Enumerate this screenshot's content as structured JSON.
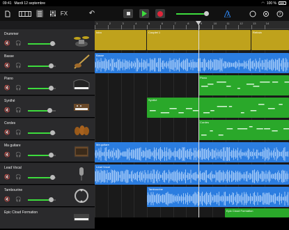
{
  "status": {
    "time": "09:41",
    "date": "Mardi 12 septembre",
    "battery": "100 %"
  },
  "toolbar": {
    "fx_label": "FX"
  },
  "colors": {
    "drums": "#bfa21c",
    "bass": "#2b7de0",
    "synth": "#2aa82a",
    "green_meter": "#3ddc3d",
    "record": "#e0263a"
  },
  "ruler": {
    "bars": [
      "1",
      "2",
      "3",
      "4",
      "5",
      "6",
      "7",
      "8",
      "9",
      "10",
      "11",
      "12",
      "13",
      "14"
    ]
  },
  "tracks": [
    {
      "name": "Drummer",
      "instrument": "drum-kit-icon"
    },
    {
      "name": "Basse",
      "instrument": "bass-guitar-icon"
    },
    {
      "name": "Piano",
      "instrument": "grand-piano-icon"
    },
    {
      "name": "Synthé",
      "instrument": "synthesizer-icon"
    },
    {
      "name": "Cordes",
      "instrument": "violins-icon"
    },
    {
      "name": "Ma guitare",
      "instrument": "guitar-amp-icon"
    },
    {
      "name": "Lead Vocal",
      "instrument": "microphone-icon"
    },
    {
      "name": "Tambourine",
      "instrument": "tambourine-icon"
    },
    {
      "name": "Epic Cloud Formation",
      "instrument": "keyboard-icon"
    }
  ],
  "regions": {
    "drummer": [
      {
        "label": "Intro"
      },
      {
        "label": "Couplet 1"
      },
      {
        "label": ""
      },
      {
        "label": "Refrain"
      }
    ],
    "bass": {
      "label": "Basse"
    },
    "piano": {
      "label": "Piano"
    },
    "synth": {
      "label": "Synthé"
    },
    "cordes": {
      "label": "Cordes"
    },
    "guitar": {
      "label": "Ma guitare"
    },
    "vocal": {
      "label": "Lead Vocal"
    },
    "tambourine": {
      "label": "Tambourine"
    },
    "epic": {
      "label": "Epic Cloud Formation"
    }
  }
}
